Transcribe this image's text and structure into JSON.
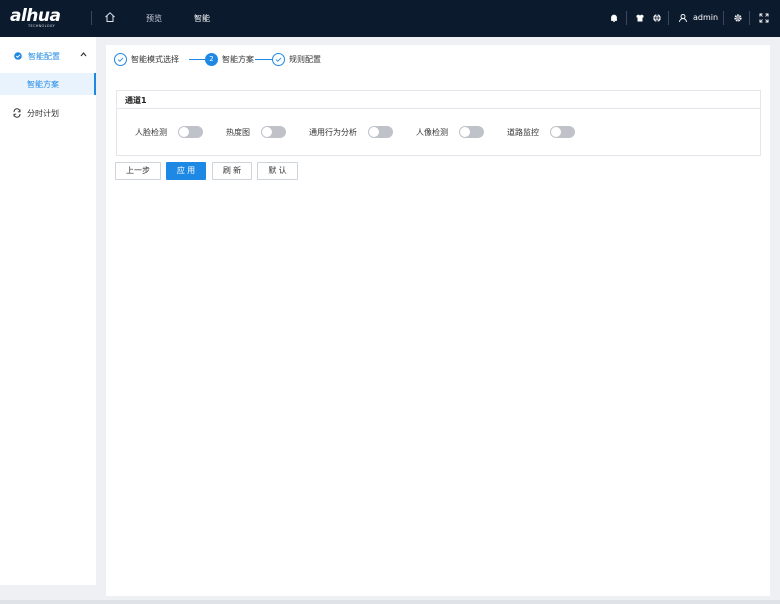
{
  "header": {
    "logo_text": "alhua",
    "logo_tagline": "TECHNOLOGY",
    "nav": [
      {
        "label": "预览"
      },
      {
        "label": "智能"
      }
    ],
    "user": "admin",
    "icons": [
      "home-icon",
      "bell-icon",
      "shirt-icon",
      "globe-icon",
      "user-icon",
      "settings-icon",
      "fullscreen-icon"
    ]
  },
  "sidebar": {
    "group": {
      "label": "智能配置",
      "expanded": true
    },
    "sub_items": [
      {
        "label": "智能方案",
        "active": true
      }
    ],
    "items": [
      {
        "label": "分时计划"
      }
    ]
  },
  "steps": [
    {
      "label": "智能模式选择",
      "state": "done"
    },
    {
      "label": "智能方案",
      "state": "current",
      "number": "2"
    },
    {
      "label": "规则配置",
      "state": "done"
    }
  ],
  "channel": {
    "title": "通道1",
    "features": [
      {
        "label": "人脸检测",
        "enabled": false
      },
      {
        "label": "热度图",
        "enabled": false
      },
      {
        "label": "通用行为分析",
        "enabled": false
      },
      {
        "label": "人像检测",
        "enabled": false
      },
      {
        "label": "道路监控",
        "enabled": false
      }
    ]
  },
  "buttons": {
    "prev": "上一步",
    "apply": "应 用",
    "refresh": "刷 新",
    "default": "默 认"
  },
  "colors": {
    "accent": "#1e88e5",
    "topbar": "#0c1a2e",
    "toggle_off": "#bfc3c9"
  }
}
